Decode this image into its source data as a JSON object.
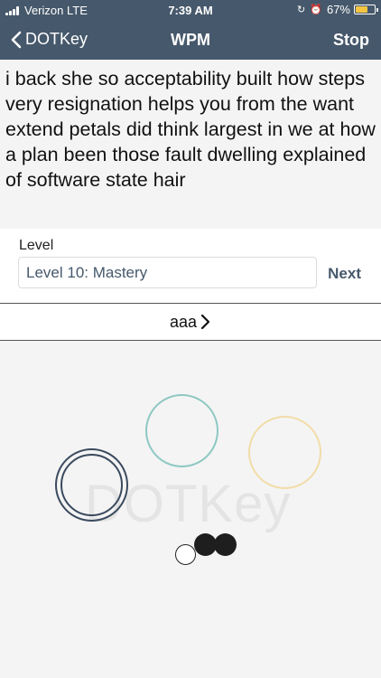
{
  "status_bar": {
    "carrier": "Verizon",
    "network": "LTE",
    "time": "7:39 AM",
    "battery_percent": "67%",
    "battery_level": 0.67,
    "icons": [
      "signal-icon",
      "lock-rotation-icon",
      "alarm-icon",
      "battery-icon"
    ],
    "battery_color": "#f5c542"
  },
  "nav": {
    "back_label": "DOTKey",
    "title": "WPM",
    "stop_label": "Stop",
    "bar_color": "#46586b"
  },
  "prompt": {
    "text": "i back she so acceptability built how steps very resignation helps you from the want extend petals did think largest in we at how a plan been those fault dwelling explained of software state hair"
  },
  "level": {
    "label": "Level",
    "value": "Level 10: Mastery",
    "next_label": "Next"
  },
  "layout_row": {
    "label": "aaa",
    "icon": "chevron-right-icon"
  },
  "dot_area": {
    "watermark": "DOTKey",
    "ring_colors": [
      "#3a4a5e",
      "#8ec8c2",
      "#f2dca8"
    ],
    "dot_colors": [
      "#ffffff",
      "#1e1e1e",
      "#1e1e1e"
    ]
  }
}
